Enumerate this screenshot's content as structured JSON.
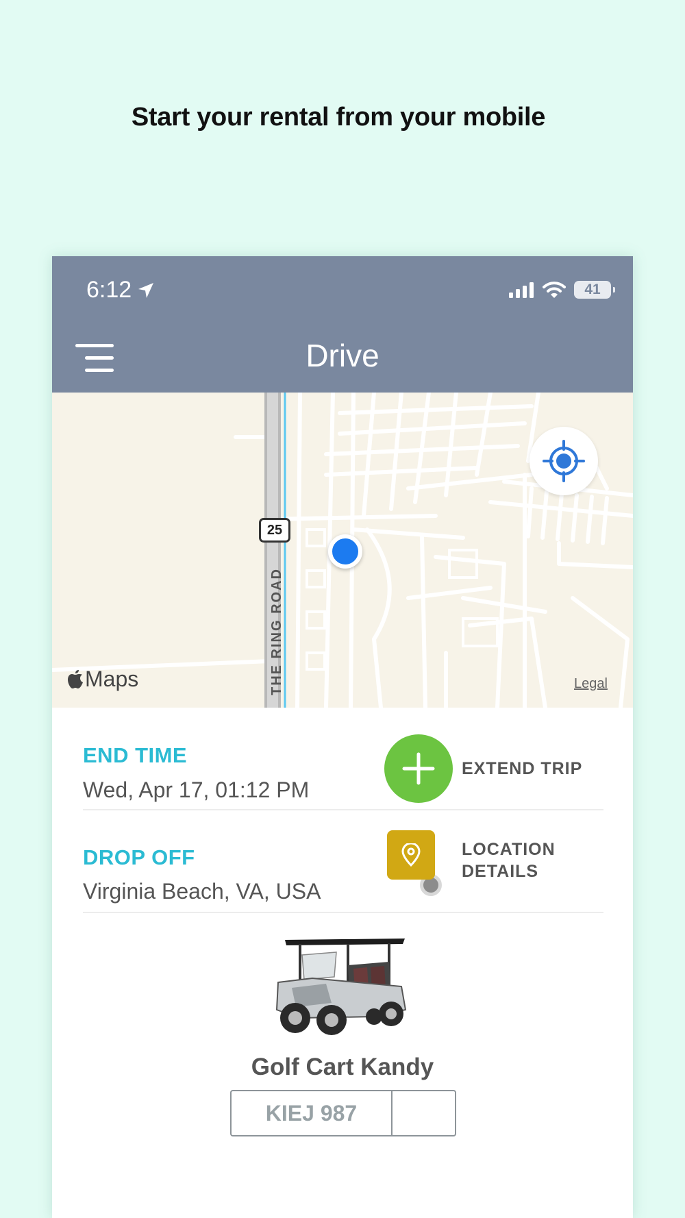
{
  "promo": {
    "title": "Start your rental from your mobile"
  },
  "status_bar": {
    "time": "6:12",
    "battery": "41"
  },
  "header": {
    "title": "Drive"
  },
  "map": {
    "highway_shield": "25",
    "road_label": "THE RING ROAD",
    "maps_logo": "Maps",
    "legal": "Legal"
  },
  "trip": {
    "end_time_label": "END TIME",
    "end_time_value": "Wed, Apr 17, 01:12 PM",
    "extend_label": "EXTEND TRIP",
    "drop_off_label": "DROP OFF",
    "drop_off_value": "Virginia Beach, VA, USA",
    "location_details_line1": "LOCATION",
    "location_details_line2": "DETAILS"
  },
  "vehicle": {
    "name": "Golf Cart Kandy",
    "plate": "KIEJ 987"
  },
  "colors": {
    "background": "#e2fbf3",
    "header": "#7a889f",
    "accent_label": "#2bbbd3",
    "extend_button": "#6cc441",
    "location_button": "#d1a814",
    "user_location": "#1c7bf0"
  },
  "icons": {
    "status": [
      "location-arrow-icon",
      "signal-icon",
      "wifi-icon",
      "battery-icon"
    ],
    "header": [
      "menu-icon"
    ],
    "map": [
      "locate-me-icon",
      "apple-logo-icon"
    ],
    "actions": [
      "plus-icon",
      "location-pin-icon"
    ]
  }
}
